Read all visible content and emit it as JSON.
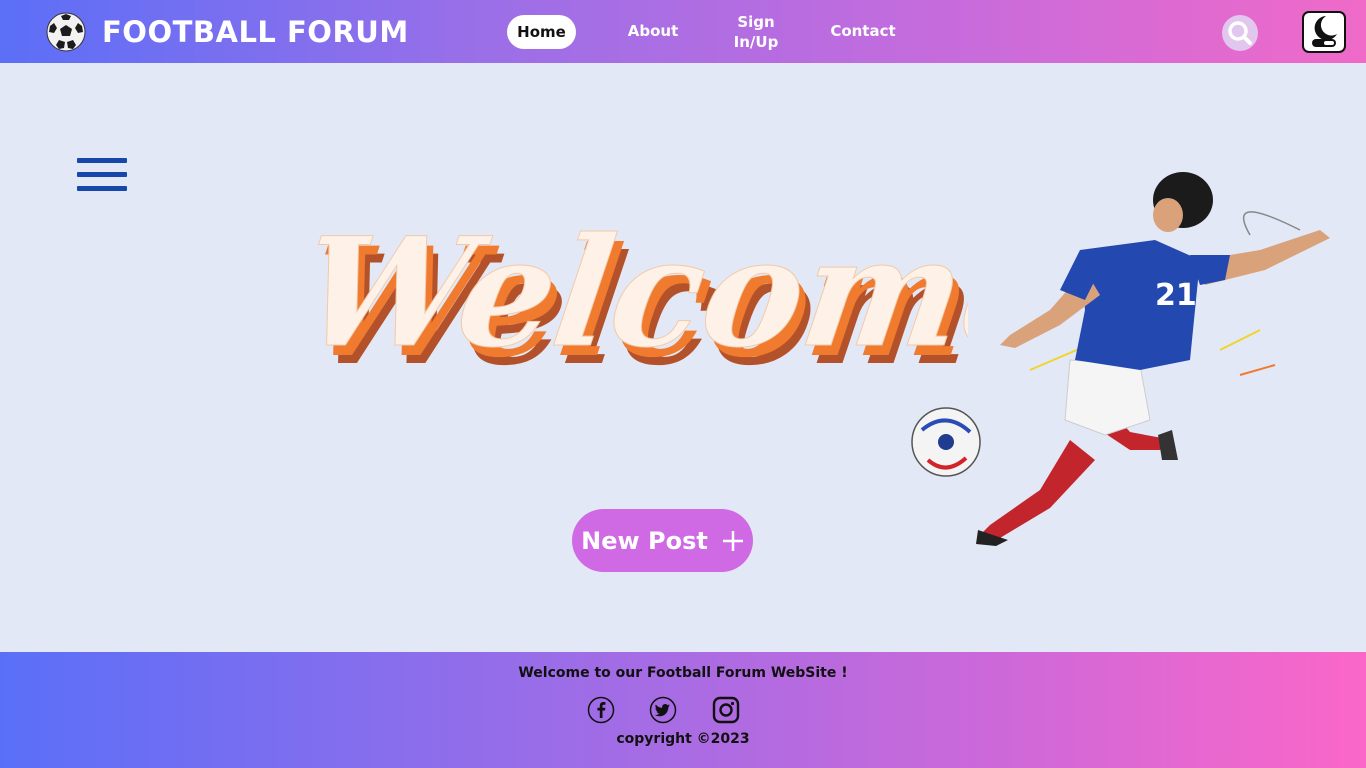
{
  "header": {
    "brand_title": "FOOTBALL FORUM",
    "logo_icon": "soccer-ball-icon",
    "nav": {
      "home": "Home",
      "about": "About",
      "sign_line1": "Sign",
      "sign_line2": "In/Up",
      "contact": "Contact"
    },
    "search_icon": "search-icon",
    "theme_icon": "dark-mode-toggle-icon",
    "active_nav": "Home"
  },
  "main": {
    "menu_icon": "hamburger-menu-icon",
    "welcome_text": "Welcome",
    "new_post_label": "New Post",
    "new_post_icon": "plus-icon"
  },
  "footer": {
    "welcome": "Welcome to our Football Forum WebSite !",
    "social": [
      "facebook-icon",
      "twitter-icon",
      "instagram-icon"
    ],
    "copyright": "copyright ©2023"
  },
  "colors": {
    "header_gradient": [
      "#5b6ff7",
      "#f06ac8"
    ],
    "page_background": "#e3e8f6",
    "accent": "#cf6ae4",
    "menu_icon": "#1548a8",
    "welcome_fill": "#fdf1e8",
    "welcome_shadow": "#f07a2e"
  }
}
